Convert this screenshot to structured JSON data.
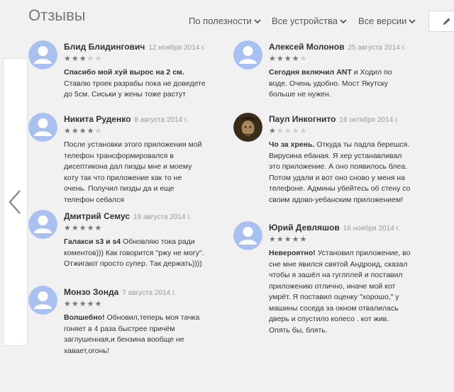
{
  "header": {
    "title": "Отзывы",
    "filters": [
      {
        "label": "По полезности",
        "icon": "chevron-down-icon"
      },
      {
        "label": "Все устройства",
        "icon": "chevron-down-icon"
      },
      {
        "label": "Все версии",
        "icon": "chevron-down-icon"
      }
    ],
    "edit_icon": "pencil-icon"
  },
  "nav": {
    "prev_icon": "chevron-left-icon"
  },
  "reviews": [
    {
      "author": "Блид Блидингович",
      "date": "12 ноября 2014 г.",
      "rating": 3,
      "headline": "Спасибо мой хуй вырос на 2 см.",
      "text": "Ставлю троек разрабы пока не доведете до 5см. Сиськи у жены тоже растут",
      "avatar": "default"
    },
    {
      "author": "Алексей Молонов",
      "date": "25 августа 2014 г.",
      "rating": 4,
      "headline": "Сегодня включил ANT",
      "text": "и Ходил по воде. Очень удобно. Мост Якутску больше не нужен.",
      "avatar": "default"
    },
    {
      "author": "Никита Руденко",
      "date": "8 августа 2014 г.",
      "rating": 4,
      "headline": "",
      "text": "После установки этого приложения мой телефон трансформировался в дисептикона дал пизды мне и моему коту так что приложение как то не очень. Получил пизды да и еще телефон себался",
      "avatar": "default"
    },
    {
      "author": "Паул Инкогнито",
      "date": "16 октября 2014 г.",
      "rating": 1,
      "headline": "Чо за хрень.",
      "text": "Откуда ты падла берешся. Вирусина ебаная. Я хер устанавливал это приложение. А оно появилось блеа. Потом удали и вот оно сново у меня на телефоне. Админы убейтесь об стену со своим адово-уебанским приложением!",
      "avatar": "photo"
    },
    {
      "author": "Дмитрий Семус",
      "date": "18 августа 2014 г.",
      "rating": 5,
      "headline": "Галакси s3 и s4",
      "text": "Обновляю тока ради коментов))) Как говорится \"ржу не могу\". Отжигают просто супер. Так держать))))",
      "avatar": "default"
    },
    {
      "author": "Юрий Девляшов",
      "date": "16 ноября 2014 г.",
      "rating": 5,
      "headline": "Невероятно!",
      "text": "Установил приложение, во сне мне явился святой Андроид, сказал чтобы я зашёл на гуглплей и поставил приложению отлично, иначе мой кот умрёт. Я поставил оценку \"хорошо,\" у машины соседа за окном отвалилась дверь и спустило колесо . кот жив. Опять бы, блять.",
      "avatar": "default"
    },
    {
      "author": "Монзо Зонда",
      "date": "7 августа 2014 г.",
      "rating": 5,
      "headline": "Волшебно!",
      "text": "Обновил,теперь моя тачка гоняет в 4 раза быстрее причём заглушенная,и бензина вообще не хавает,огонь!",
      "avatar": "default"
    }
  ]
}
